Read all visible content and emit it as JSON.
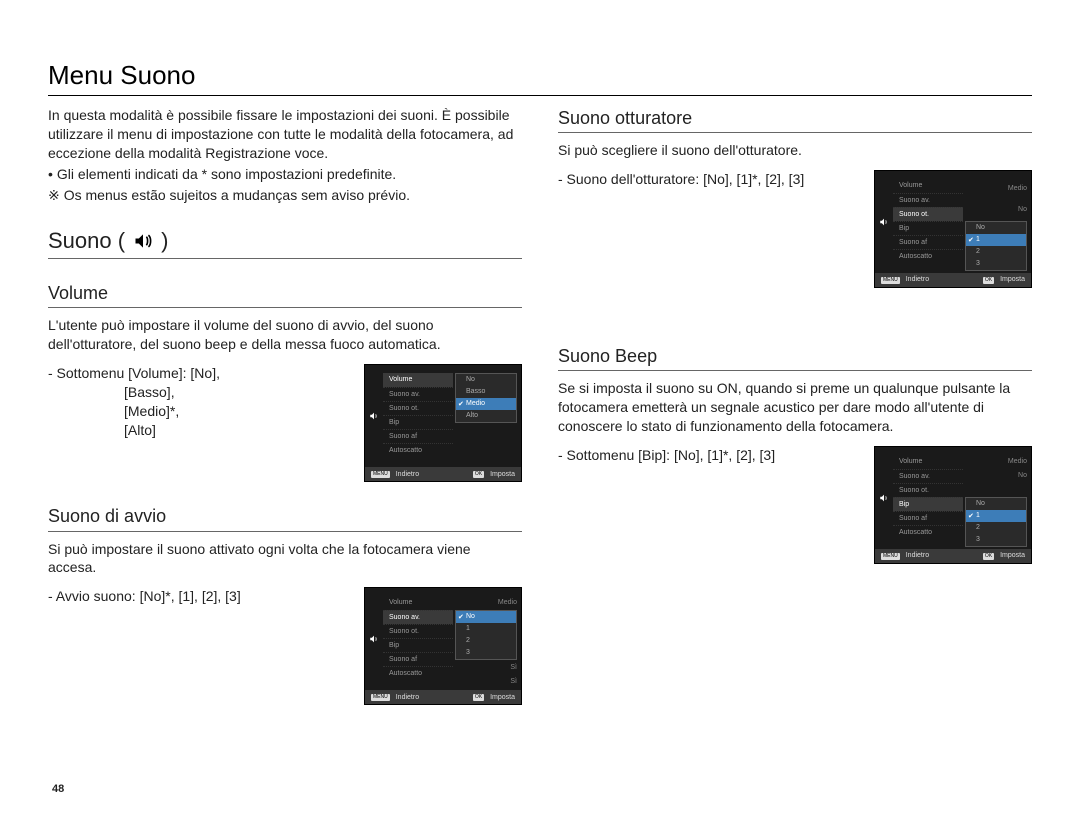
{
  "page": {
    "title": "Menu Suono",
    "intro1": "In questa modalità è possibile fissare le impostazioni dei suoni. È possibile utilizzare il menu di impostazione con tutte le modalità della fotocamera, ad eccezione della modalità Registrazione voce.",
    "bullet1": "Gli elementi indicati da * sono impostazioni predefinite.",
    "note_sym": "※",
    "note1": "Os menus estão sujeitos a mudanças sem aviso prévio.",
    "number": "48"
  },
  "sound": {
    "heading": "Suono ( ",
    "heading_close": " )"
  },
  "volume": {
    "heading": "Volume",
    "desc": "L'utente può impostare il volume del suono di avvio, del suono dell'otturatore, del suono beep e della messa fuoco automatica.",
    "label": "- Sottomenu [Volume]: [No],",
    "o1": "[Basso],",
    "o2": "[Medio]*,",
    "o3": "[Alto]"
  },
  "avvio": {
    "heading": "Suono di avvio",
    "desc": "Si può impostare il suono attivato ogni volta che la fotocamera viene accesa.",
    "label": "- Avvio suono: [No]*, [1], [2], [3]"
  },
  "ott": {
    "heading": "Suono otturatore",
    "desc": "Si può scegliere il suono dell'otturatore.",
    "label": "- Suono dell'otturatore: [No], [1]*, [2], [3]"
  },
  "beep": {
    "heading": "Suono Beep",
    "desc": "Se si imposta il suono su ON, quando si preme un qualunque pulsante la fotocamera emetterà un segnale acustico per dare modo all'utente di conoscere lo stato di funzionamento della fotocamera.",
    "label": "- Sottomenu [Bip]: [No], [1]*, [2], [3]"
  },
  "lcd": {
    "menu": {
      "volume": "Volume",
      "suono_av": "Suono av.",
      "suono_ot": "Suono ot.",
      "bip": "Bip",
      "suono_af": "Suono af",
      "autoscatto": "Autoscatto"
    },
    "values": {
      "medio": "Medio",
      "no": "No",
      "basso": "Basso",
      "alto": "Alto",
      "one": "1",
      "two": "2",
      "three": "3",
      "si": "Sì"
    },
    "foot": {
      "menu_btn": "MENU",
      "indietro": "Indietro",
      "ok_btn": "OK",
      "imposta": "Imposta"
    }
  }
}
